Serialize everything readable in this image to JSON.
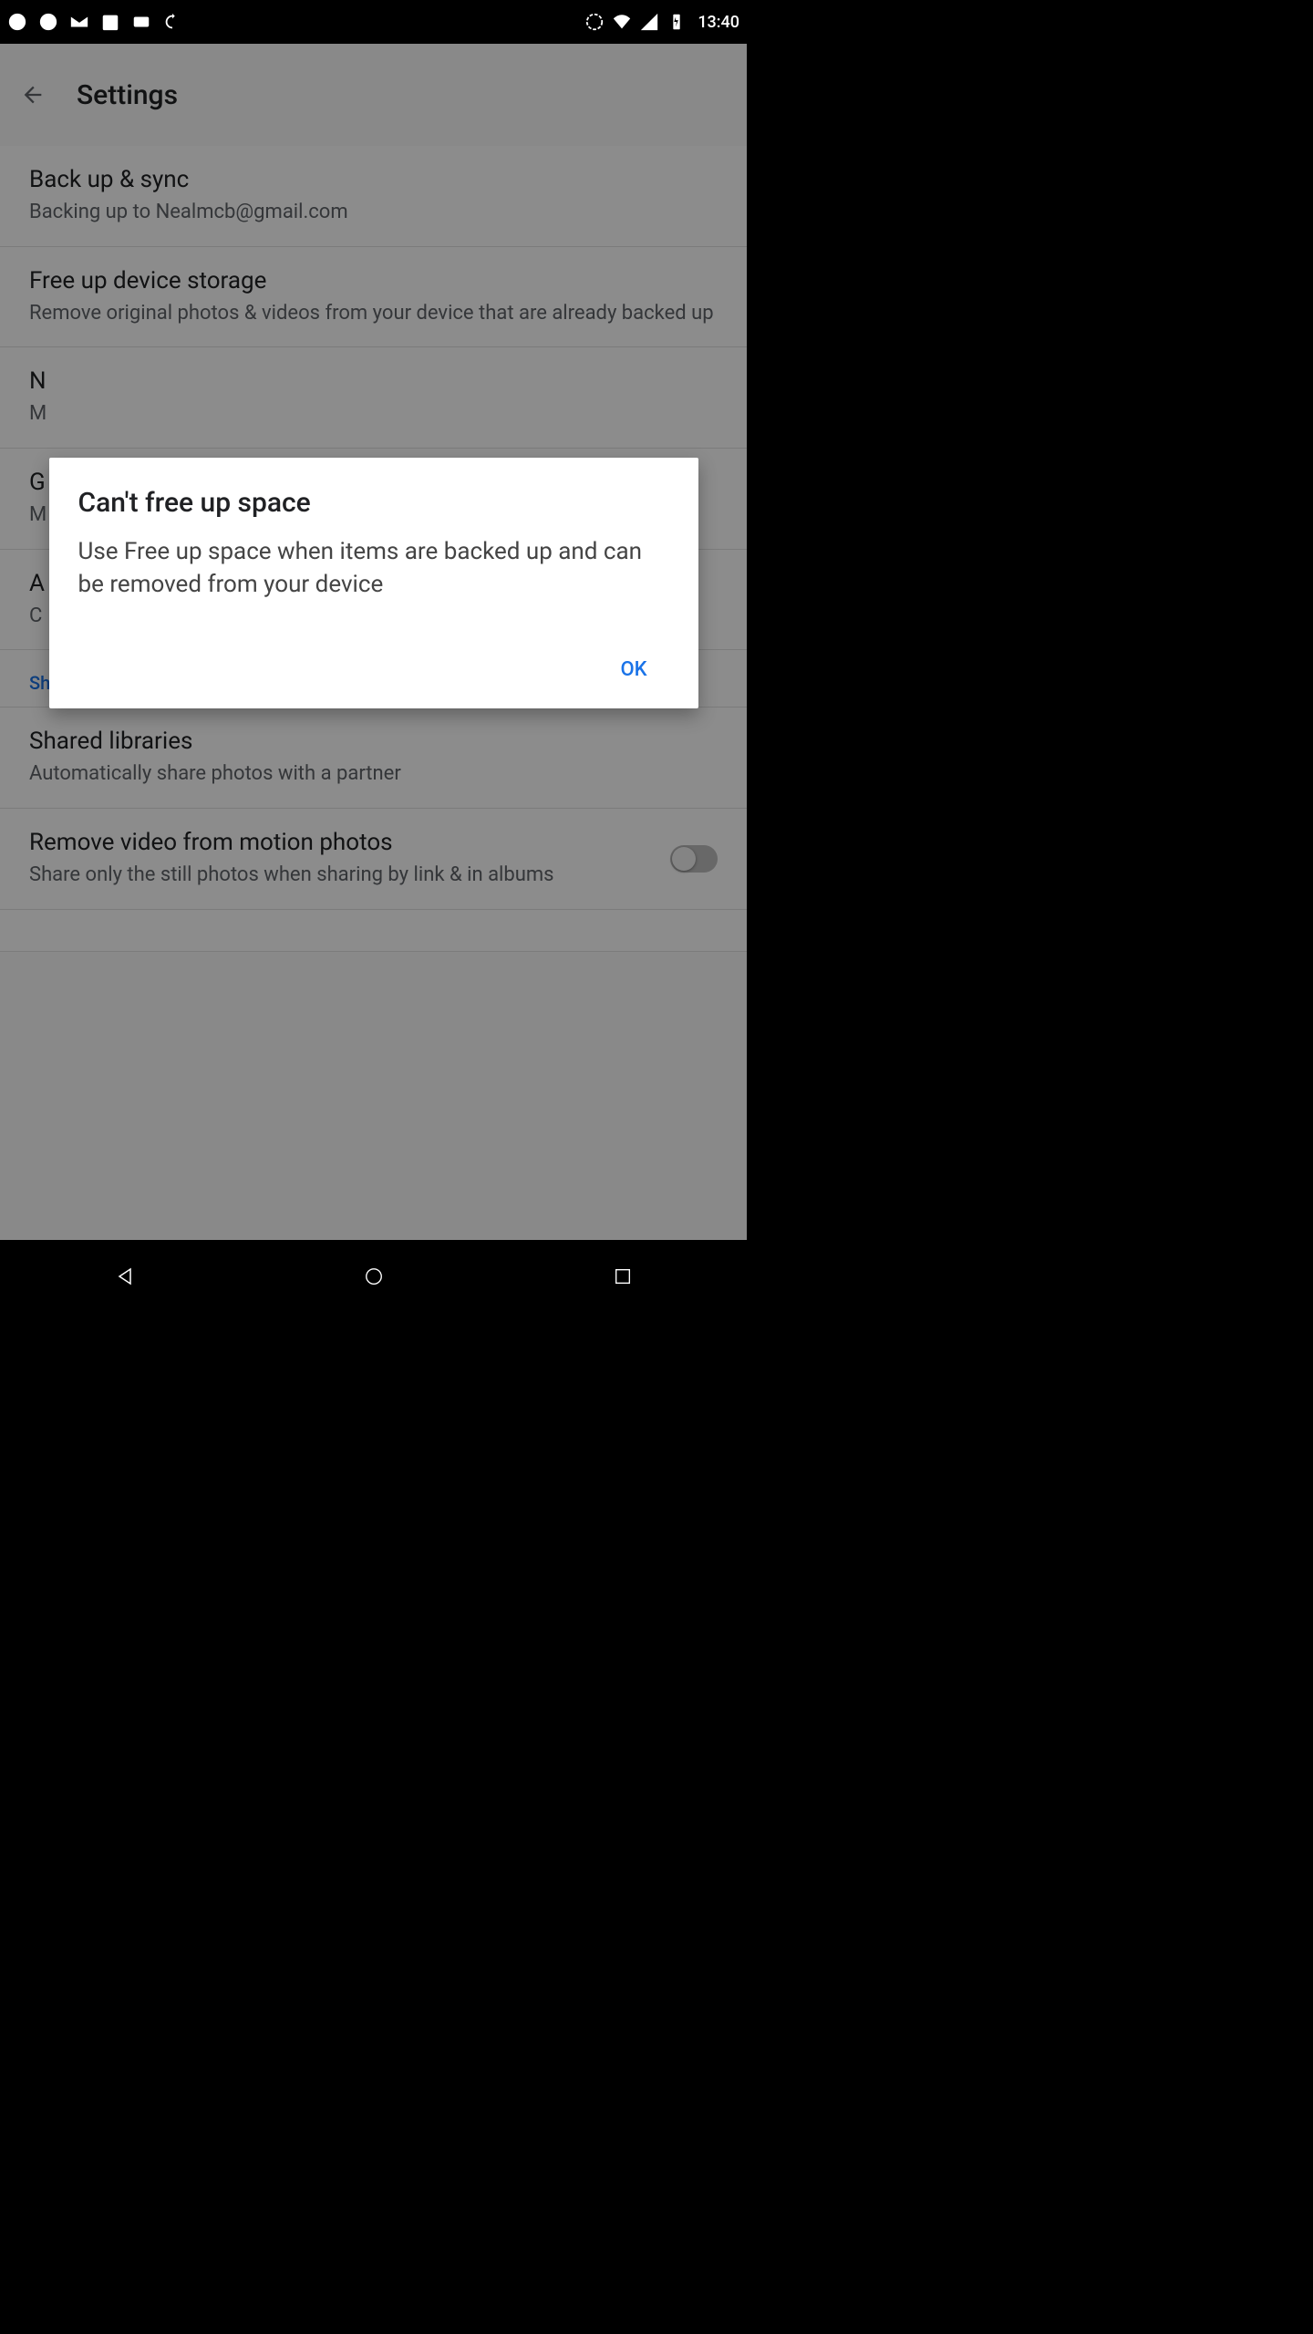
{
  "status": {
    "clock": "13:40"
  },
  "appbar": {
    "title": "Settings"
  },
  "settings": {
    "items": [
      {
        "title": "Back up & sync",
        "sub": "Backing up to Nealmcb@gmail.com"
      },
      {
        "title": "Free up device storage",
        "sub": "Remove original photos & videos from your device that are already backed up"
      },
      {
        "title": "N",
        "sub": "M"
      },
      {
        "title": "G",
        "sub": "M"
      },
      {
        "title": "A",
        "sub": "C"
      }
    ],
    "section_sharing": "Sharing",
    "sharing_items": [
      {
        "title": "Shared libraries",
        "sub": "Automatically share photos with a partner"
      },
      {
        "title": "Remove video from motion photos",
        "sub": "Share only the still photos when sharing by link & in albums"
      }
    ]
  },
  "dialog": {
    "title": "Can't free up space",
    "body": "Use Free up space when items are backed up and can be removed from your device",
    "ok": "OK"
  }
}
